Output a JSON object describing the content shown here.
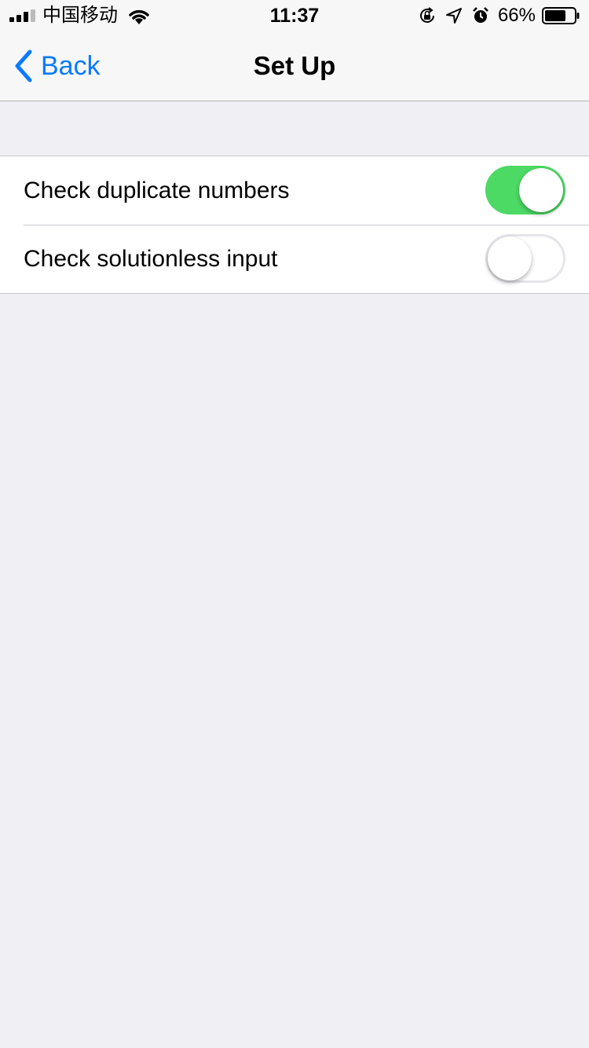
{
  "status_bar": {
    "carrier": "中国移动",
    "time": "11:37",
    "battery_percent": "66%",
    "icons": [
      "signal-icon",
      "wifi-icon",
      "orientation-lock-icon",
      "location-icon",
      "alarm-icon",
      "battery-icon"
    ]
  },
  "nav": {
    "back_label": "Back",
    "title": "Set Up",
    "accent_color": "#0a7aff"
  },
  "settings": [
    {
      "label": "Check duplicate numbers",
      "enabled": true
    },
    {
      "label": "Check solutionless input",
      "enabled": false
    }
  ],
  "colors": {
    "background": "#efeff4",
    "toggle_on": "#4cd964",
    "bar_background": "#f7f7f7"
  }
}
